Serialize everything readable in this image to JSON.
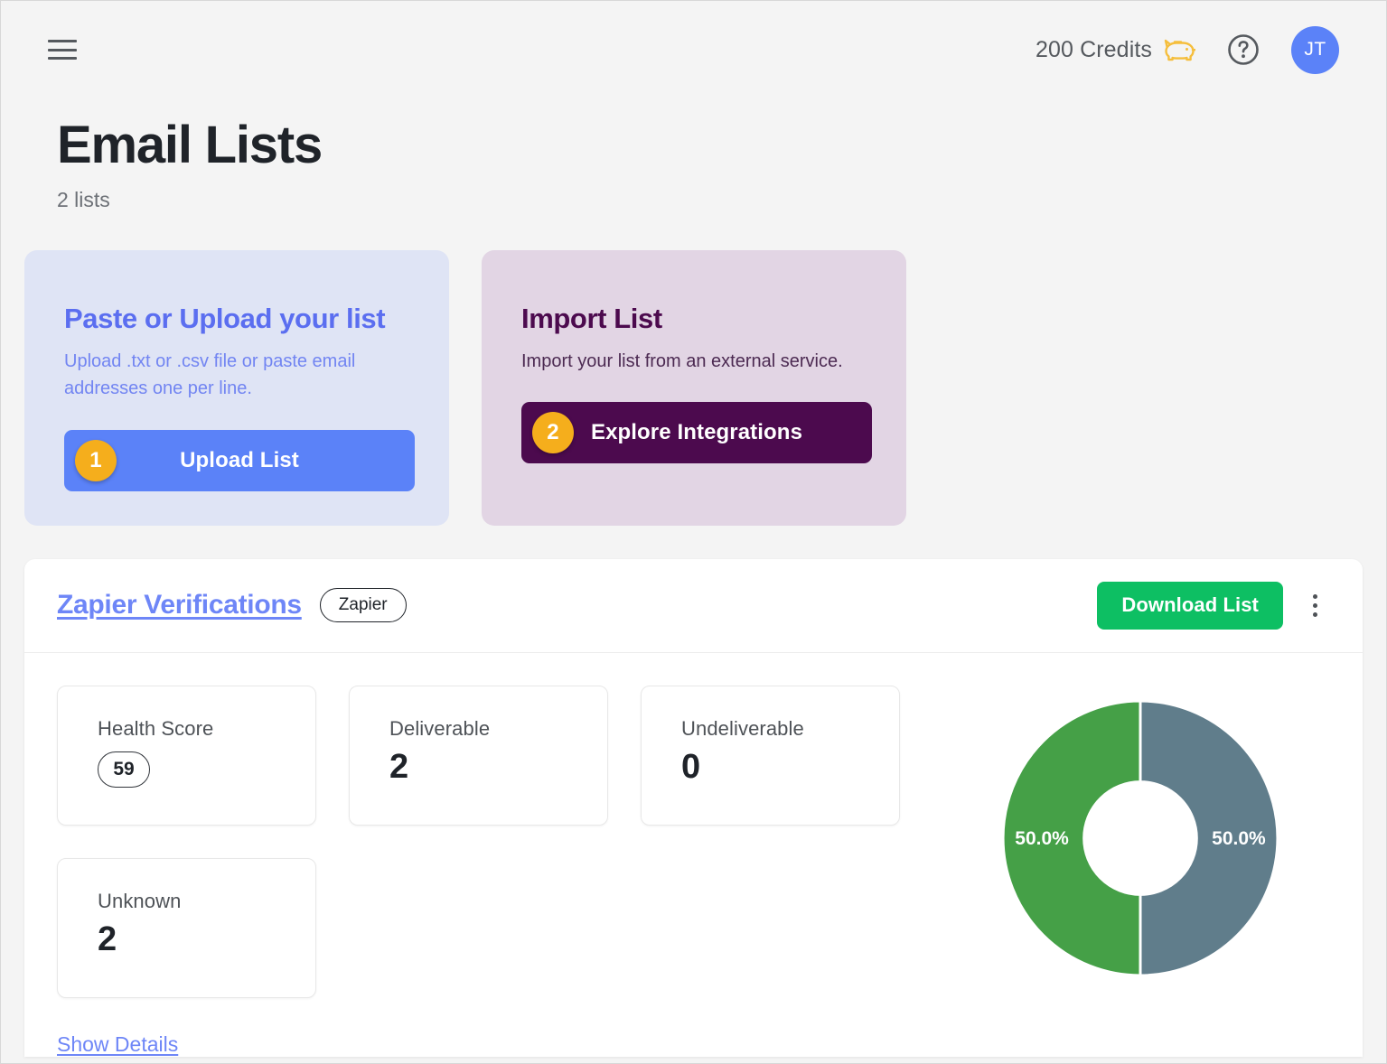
{
  "topbar": {
    "menu_icon": "hamburger-icon",
    "credits_label": "200 Credits",
    "piggy_icon": "piggy-bank-icon",
    "help_icon": "help-circle-icon",
    "avatar_initials": "JT",
    "avatar_color": "#5b82f8"
  },
  "page": {
    "title": "Email Lists",
    "subtitle": "2 lists"
  },
  "action_cards": [
    {
      "title": "Paste or Upload your list",
      "description": "Upload .txt or .csv file or paste email addresses one per line.",
      "button_label": "Upload List",
      "step": "1",
      "background": "#dfe4f5",
      "button_color": "#5b82f8"
    },
    {
      "title": "Import List",
      "description": "Import your list from an external service.",
      "button_label": "Explore Integrations",
      "step": "2",
      "background": "#e2d5e4",
      "button_color": "#4c0a4e"
    }
  ],
  "list": {
    "name": "Zapier Verifications",
    "source_badge": "Zapier",
    "download_label": "Download List",
    "menu_icon": "more-vertical-icon",
    "show_details_label": "Show Details",
    "stats": [
      {
        "label": "Health Score",
        "value": "59",
        "style": "pill"
      },
      {
        "label": "Deliverable",
        "value": "2",
        "style": "number"
      },
      {
        "label": "Undeliverable",
        "value": "0",
        "style": "number"
      },
      {
        "label": "Unknown",
        "value": "2",
        "style": "number"
      }
    ]
  },
  "chart_data": {
    "type": "pie",
    "title": "",
    "donut": true,
    "inner_radius_ratio": 0.41,
    "legend_position": "none",
    "categories": [
      "Unknown",
      "Deliverable"
    ],
    "values": [
      50.0,
      50.0
    ],
    "labels": [
      "50.0%",
      "50.0%"
    ],
    "colors": [
      "#607d8b",
      "#45a047"
    ],
    "series": [
      {
        "name": "Unknown",
        "value": 50.0,
        "label": "50.0%",
        "color": "#607d8b"
      },
      {
        "name": "Deliverable",
        "value": 50.0,
        "label": "50.0%",
        "color": "#45a047"
      }
    ]
  }
}
